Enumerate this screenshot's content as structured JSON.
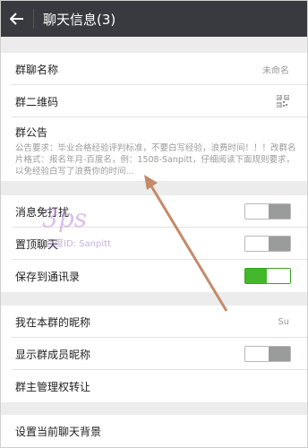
{
  "header": {
    "title": "聊天信息(3)"
  },
  "group": {
    "name_label": "群聊名称",
    "name_value": "未命名",
    "qr_label": "群二维码",
    "notice_label": "群公告",
    "notice_text": "公告要求：毕业合格经验评判标准，不要白写经验，浪费时间！！！改群名片格式：报名年月-百度名，例：1508-Sanpitt，仔细阅读下面规则要求，以免经验白写了浪费你的时间..."
  },
  "settings": {
    "mute_label": "消息免打扰",
    "mute_on": false,
    "pin_label": "置顶聊天",
    "pin_on": false,
    "save_label": "保存到通讯录",
    "save_on": true
  },
  "profile": {
    "nickname_label": "我在本群的昵称",
    "nickname_value": "Su",
    "show_names_label": "显示群成员昵称",
    "show_names_on": false,
    "transfer_label": "群主管理权转让"
  },
  "misc": {
    "background_label": "设置当前聊天背景"
  },
  "watermark": {
    "big": "3ps",
    "small": "百度ID: Sanpitt"
  },
  "colors": {
    "topbar": "#393a3f",
    "toggle_on": "#42b82a",
    "arrow": "#c48a68"
  },
  "icons": {
    "back": "arrow-left-icon",
    "qr": "qr-code-icon"
  }
}
